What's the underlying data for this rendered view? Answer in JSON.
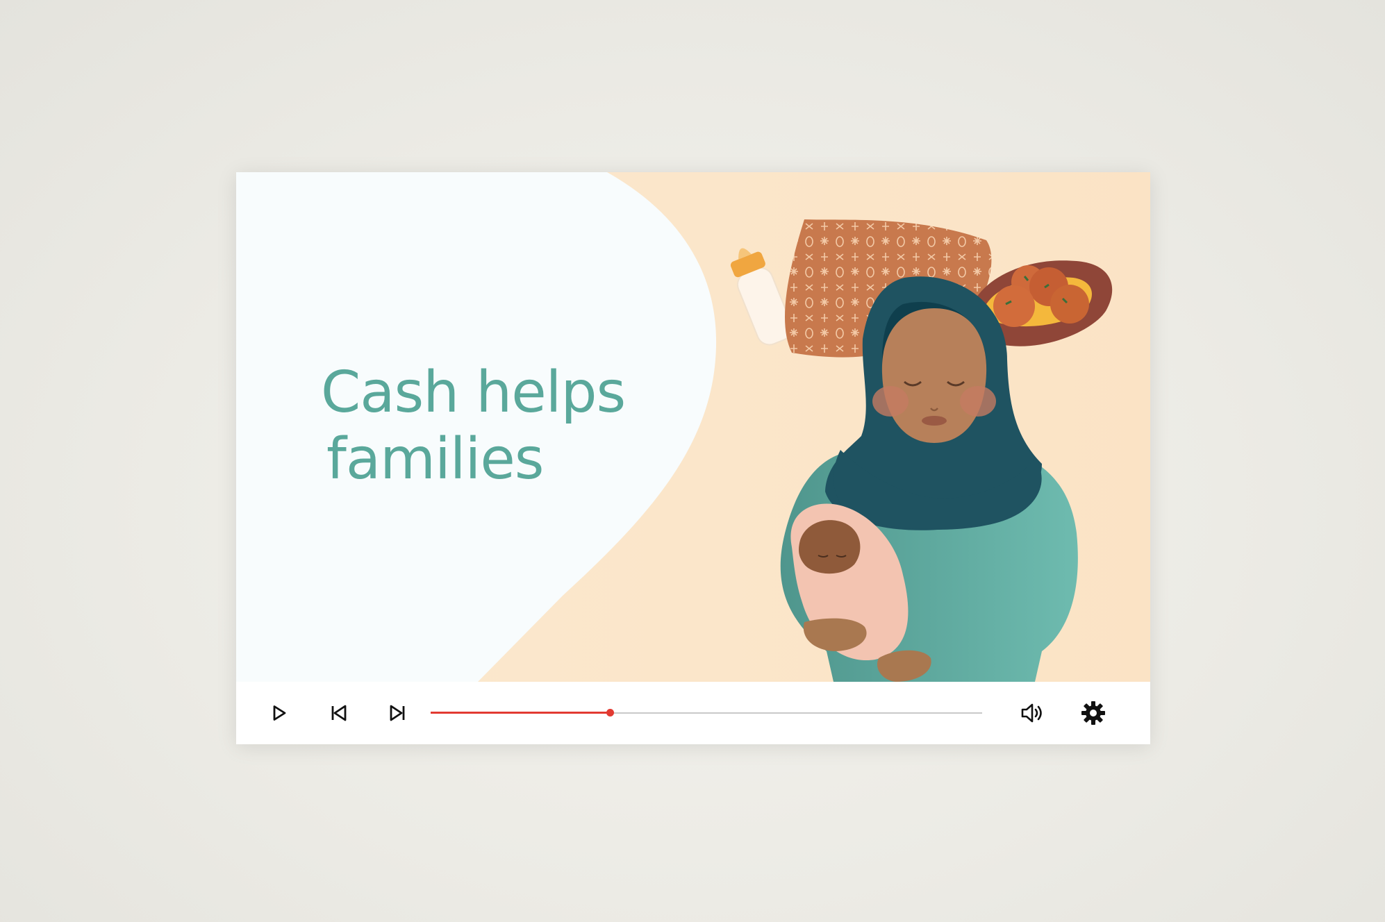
{
  "video": {
    "headline_line1": "Cash helps",
    "headline_line2": "families"
  },
  "player": {
    "progress_fraction": 0.325,
    "accent_color": "#e23a32",
    "controls": [
      {
        "name": "play-button",
        "icon": "play-icon"
      },
      {
        "name": "previous-button",
        "icon": "skip-previous-icon"
      },
      {
        "name": "next-button",
        "icon": "skip-next-icon"
      },
      {
        "name": "volume-button",
        "icon": "volume-icon"
      },
      {
        "name": "settings-button",
        "icon": "gear-icon"
      }
    ]
  }
}
